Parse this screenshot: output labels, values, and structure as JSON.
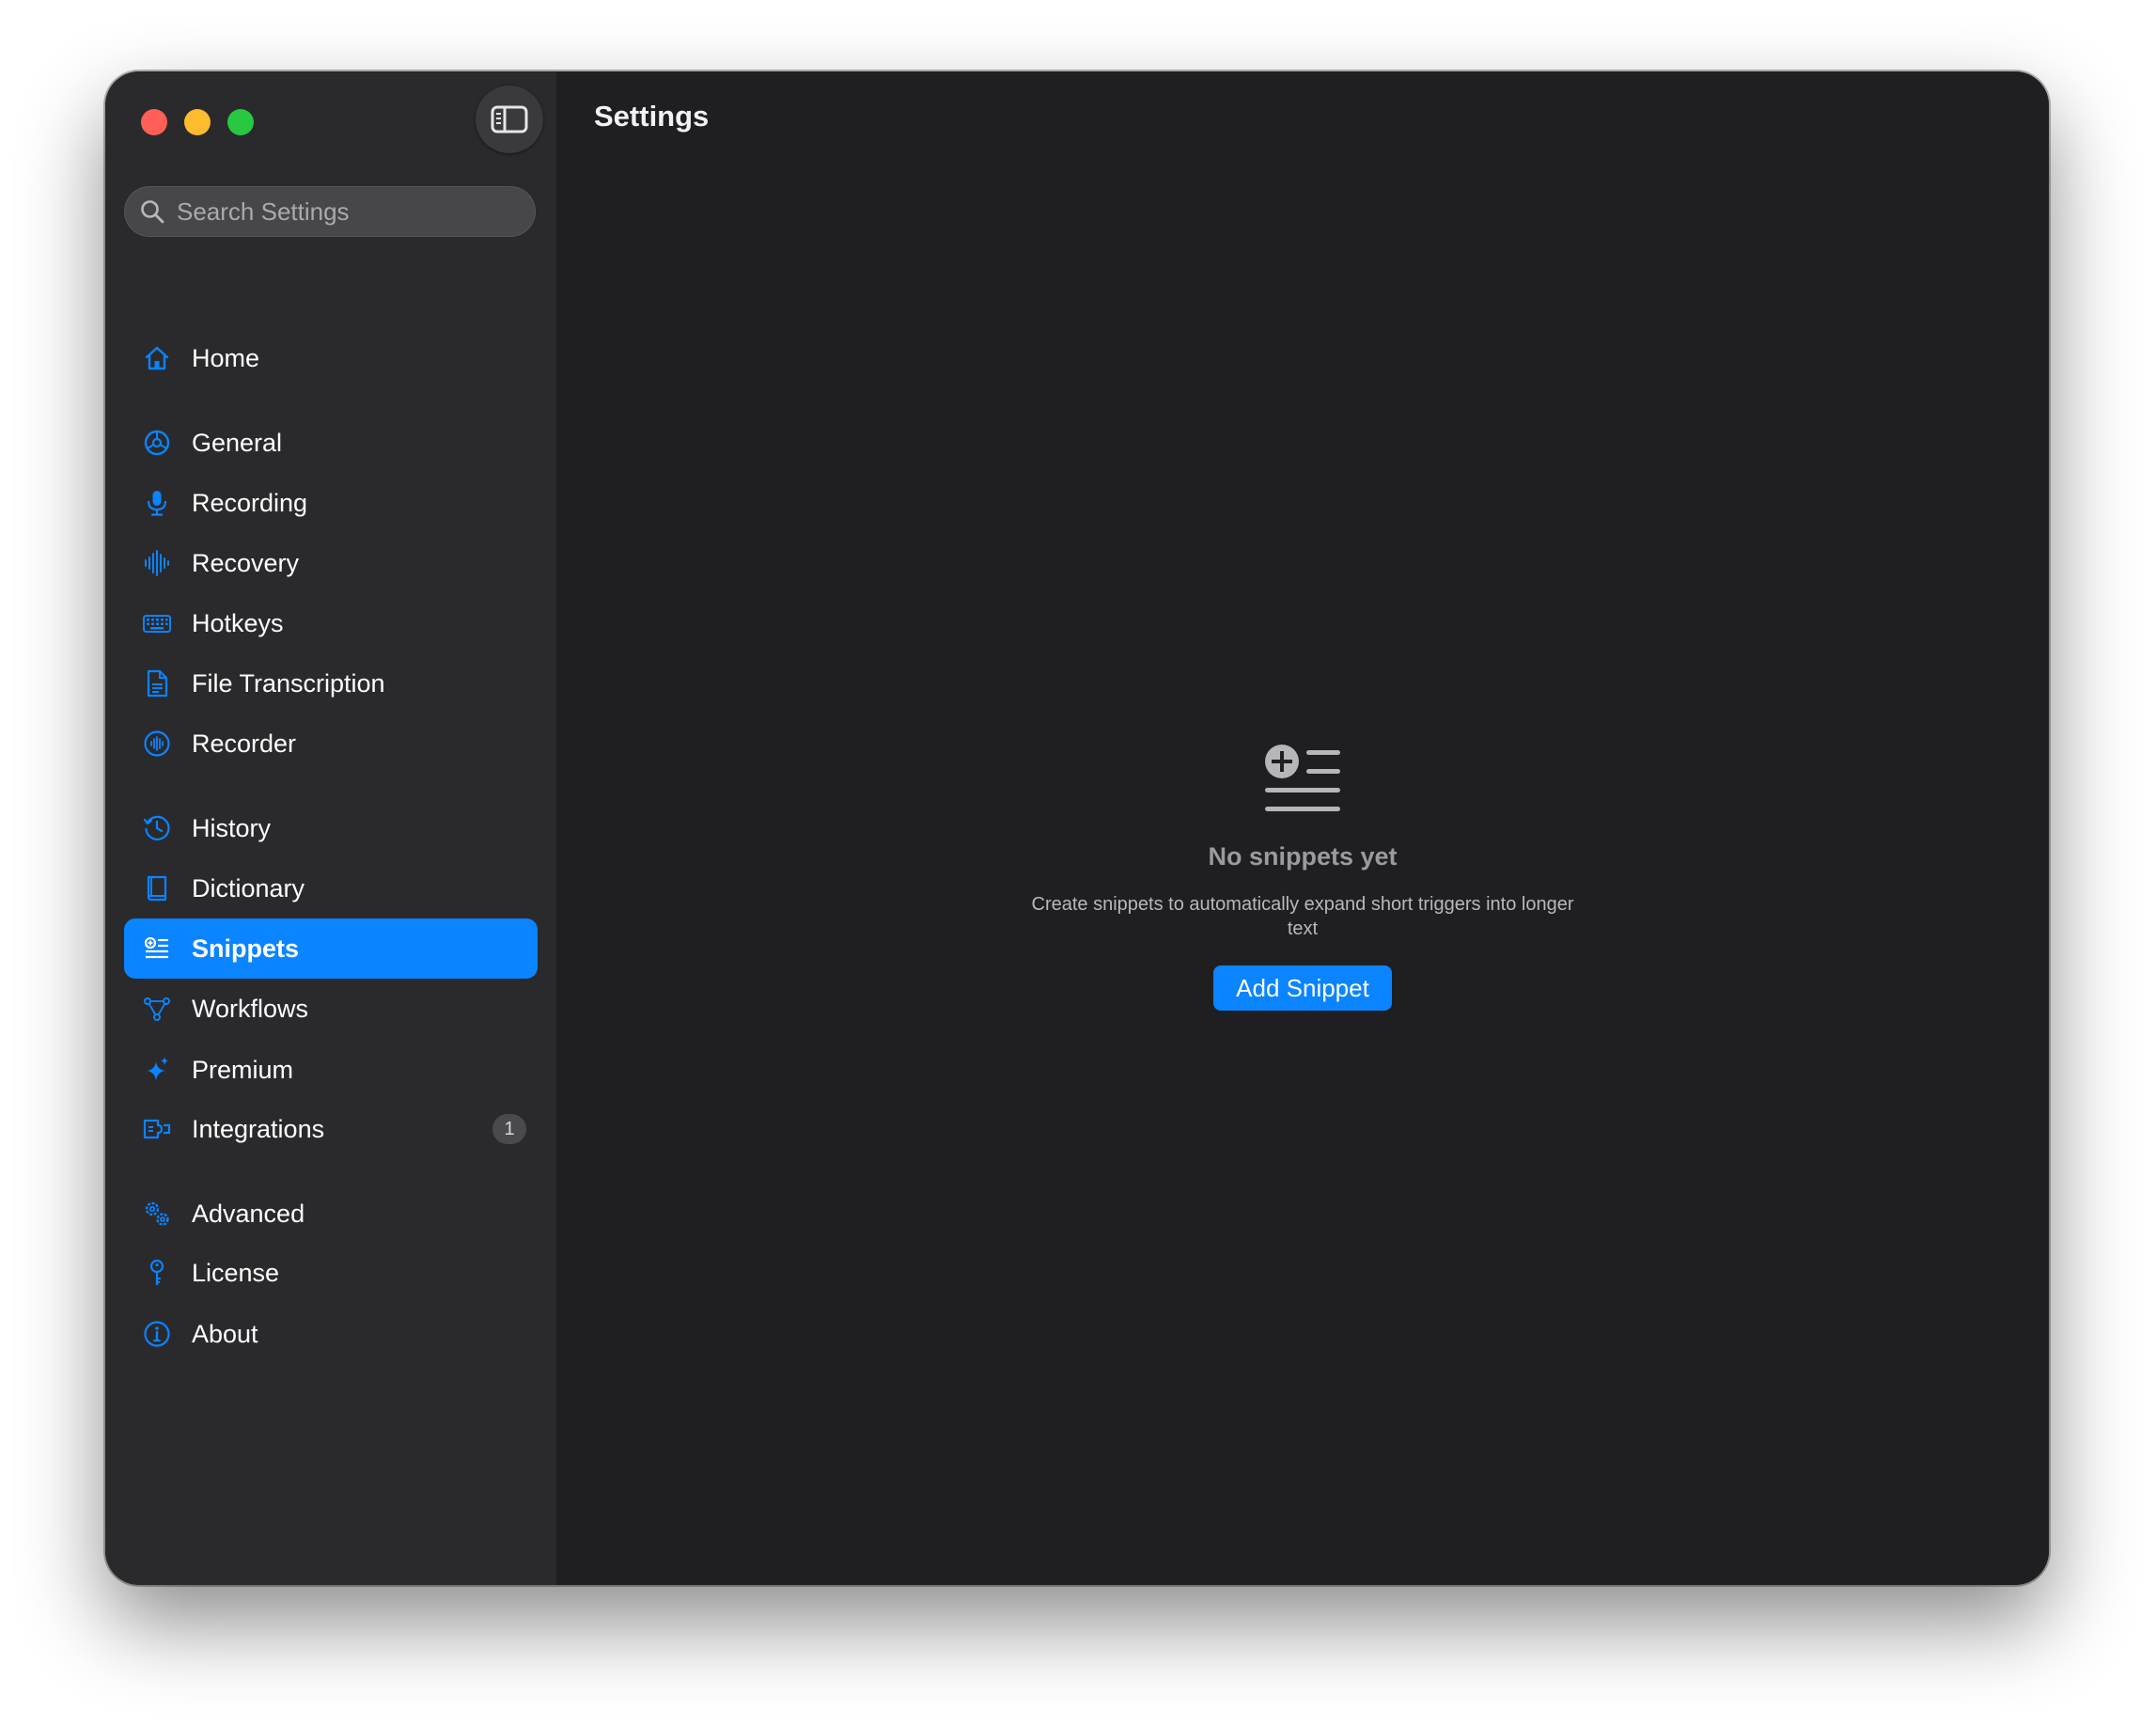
{
  "window": {
    "controls": [
      "close",
      "minimize",
      "zoom"
    ]
  },
  "sidebar": {
    "toggle_icon": "sidebar-toggle-icon",
    "search": {
      "placeholder": "Search Settings",
      "value": "",
      "icon": "search-icon"
    },
    "items": [
      {
        "label": "Home",
        "icon": "house-icon"
      },
      {
        "label": "General",
        "icon": "dial-icon"
      },
      {
        "label": "Recording",
        "icon": "microphone-icon"
      },
      {
        "label": "Recovery",
        "icon": "waveform-icon"
      },
      {
        "label": "Hotkeys",
        "icon": "keyboard-icon"
      },
      {
        "label": "File Transcription",
        "icon": "document-icon"
      },
      {
        "label": "Recorder",
        "icon": "record-circle-icon"
      },
      {
        "label": "History",
        "icon": "clock-history-icon"
      },
      {
        "label": "Dictionary",
        "icon": "book-icon"
      },
      {
        "label": "Snippets",
        "icon": "snippets-list-icon",
        "active": true
      },
      {
        "label": "Workflows",
        "icon": "flow-nodes-icon"
      },
      {
        "label": "Premium",
        "icon": "sparkle-icon"
      },
      {
        "label": "Integrations",
        "icon": "plug-in-icon",
        "badge": "1"
      },
      {
        "label": "Advanced",
        "icon": "gears-icon"
      },
      {
        "label": "License",
        "icon": "key-icon"
      },
      {
        "label": "About",
        "icon": "info-circle-icon"
      }
    ]
  },
  "main": {
    "title": "Settings",
    "empty_state": {
      "icon": "add-list-icon",
      "title": "No snippets yet",
      "description": "Create snippets to automatically expand short triggers into longer text",
      "button_label": "Add Snippet"
    }
  },
  "colors": {
    "accent": "#0a84ff",
    "sidebar_bg": "#2a2a2d",
    "content_bg": "#1f1f21",
    "close": "#ff5f57",
    "minimize": "#febc2e",
    "zoom": "#28c840"
  }
}
